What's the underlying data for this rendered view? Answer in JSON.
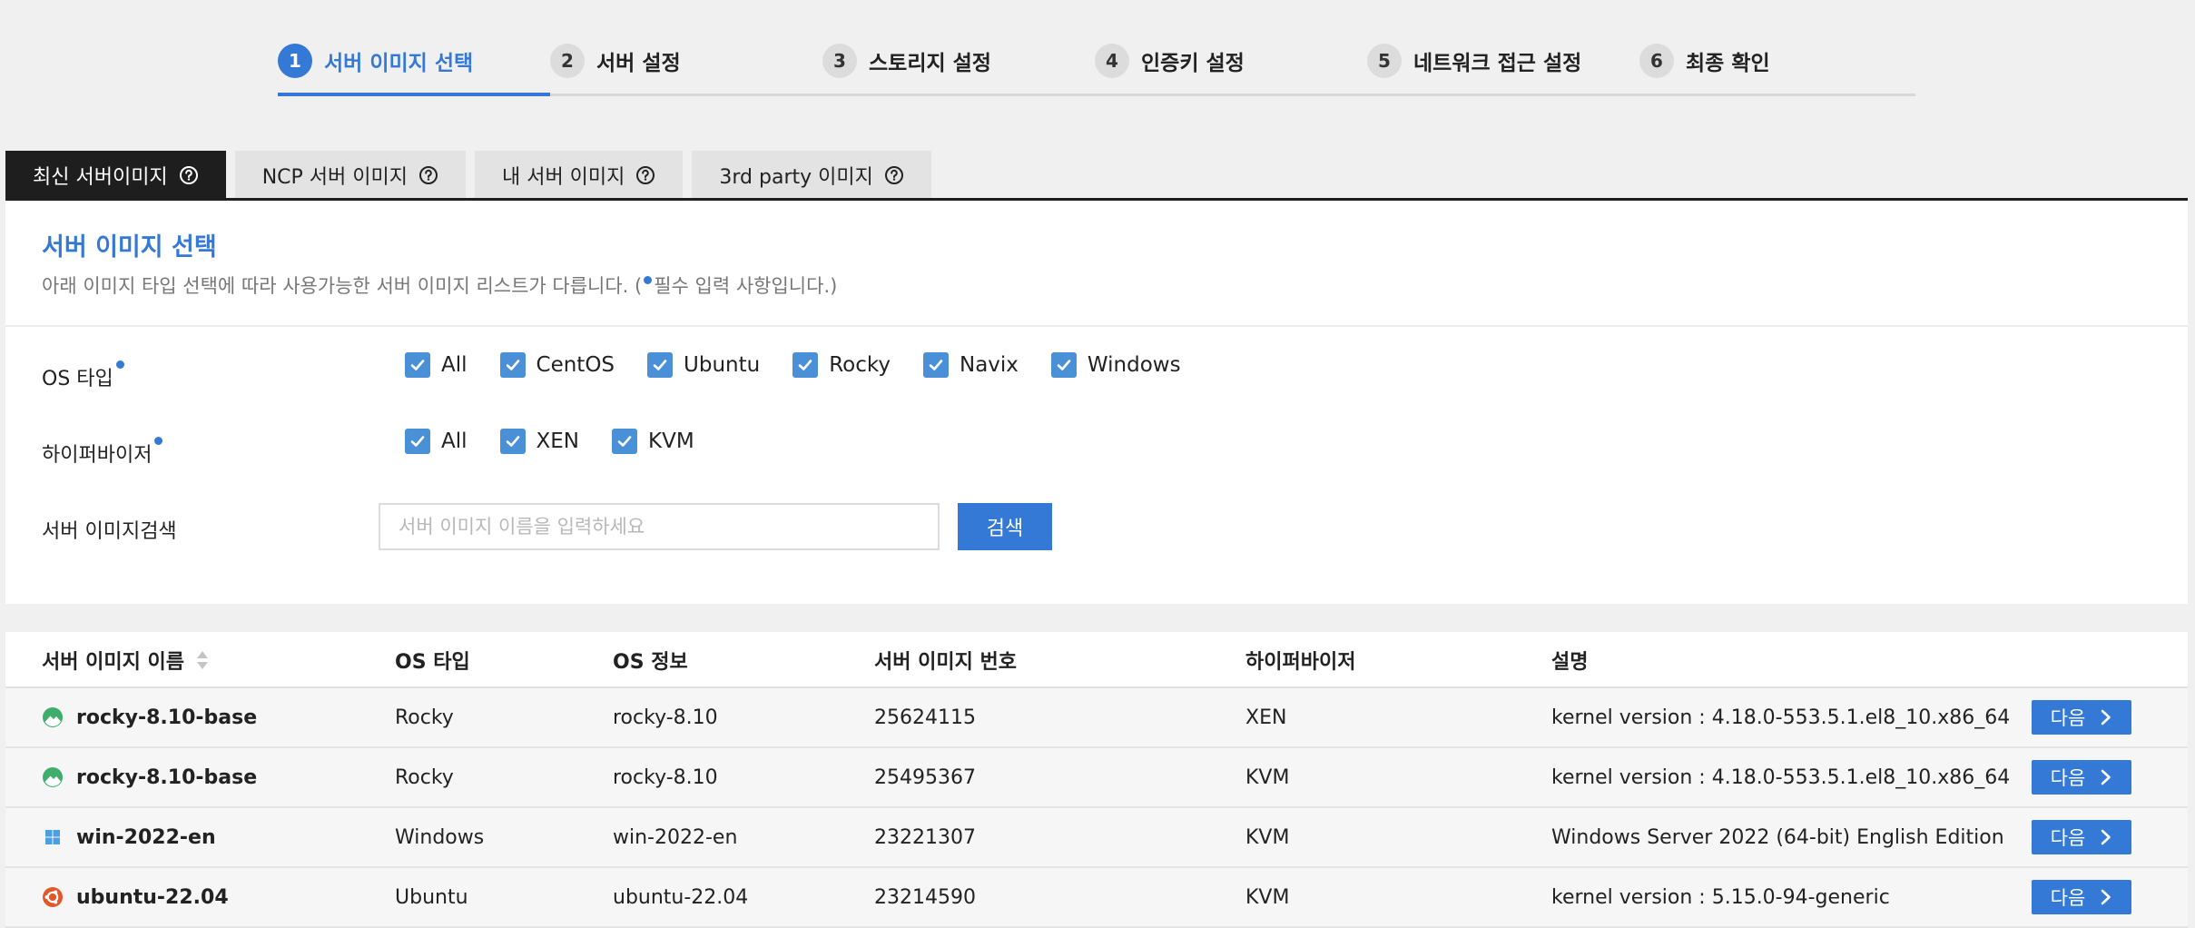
{
  "stepper": {
    "steps": [
      {
        "num": "1",
        "label": "서버 이미지 선택"
      },
      {
        "num": "2",
        "label": "서버 설정"
      },
      {
        "num": "3",
        "label": "스토리지 설정"
      },
      {
        "num": "4",
        "label": "인증키 설정"
      },
      {
        "num": "5",
        "label": "네트워크 접근 설정"
      },
      {
        "num": "6",
        "label": "최종 확인"
      }
    ],
    "active_step": 1
  },
  "tabs": [
    {
      "label": "최신 서버이미지",
      "icon": "help-circle-icon",
      "active": true
    },
    {
      "label": "NCP 서버 이미지",
      "icon": "help-circle-icon",
      "active": false
    },
    {
      "label": "내 서버 이미지",
      "icon": "help-circle-icon",
      "active": false
    },
    {
      "label": "3rd party 이미지",
      "icon": "help-circle-icon",
      "active": false
    }
  ],
  "panel": {
    "title": "서버 이미지 선택",
    "desc_before": "아래 이미지 타입 선택에 따라 사용가능한 서버 이미지 리스트가 다릅니다. (",
    "desc_after": "필수 입력 사항입니다.)"
  },
  "filters": {
    "os_type": {
      "label": "OS 타입",
      "options": [
        {
          "label": "All",
          "checked": true
        },
        {
          "label": "CentOS",
          "checked": true
        },
        {
          "label": "Ubuntu",
          "checked": true
        },
        {
          "label": "Rocky",
          "checked": true
        },
        {
          "label": "Navix",
          "checked": true
        },
        {
          "label": "Windows",
          "checked": true
        }
      ]
    },
    "hypervisor": {
      "label": "하이퍼바이저",
      "options": [
        {
          "label": "All",
          "checked": true
        },
        {
          "label": "XEN",
          "checked": true
        },
        {
          "label": "KVM",
          "checked": true
        }
      ]
    },
    "search": {
      "label": "서버 이미지검색",
      "placeholder": "서버 이미지 이름을 입력하세요",
      "value": "",
      "button_label": "검색"
    }
  },
  "table": {
    "columns": {
      "name": "서버 이미지 이름",
      "os_type": "OS 타입",
      "os_info": "OS 정보",
      "image_num": "서버 이미지 번호",
      "hypervisor": "하이퍼바이저",
      "description": "설명"
    },
    "rows": [
      {
        "icon": "rocky-icon",
        "name": "rocky-8.10-base",
        "os_type": "Rocky",
        "os_info": "rocky-8.10",
        "image_num": "25624115",
        "hypervisor": "XEN",
        "description": "kernel version : 4.18.0-553.5.1.el8_10.x86_64",
        "action": "다음"
      },
      {
        "icon": "rocky-icon",
        "name": "rocky-8.10-base",
        "os_type": "Rocky",
        "os_info": "rocky-8.10",
        "image_num": "25495367",
        "hypervisor": "KVM",
        "description": "kernel version : 4.18.0-553.5.1.el8_10.x86_64",
        "action": "다음"
      },
      {
        "icon": "windows-icon",
        "name": "win-2022-en",
        "os_type": "Windows",
        "os_info": "win-2022-en",
        "image_num": "23221307",
        "hypervisor": "KVM",
        "description": "Windows Server 2022 (64-bit) English Edition",
        "action": "다음"
      },
      {
        "icon": "ubuntu-icon",
        "name": "ubuntu-22.04",
        "os_type": "Ubuntu",
        "os_info": "ubuntu-22.04",
        "image_num": "23214590",
        "hypervisor": "KVM",
        "description": "kernel version : 5.15.0-94-generic",
        "action": "다음"
      }
    ]
  },
  "colors": {
    "accent": "#3579d6",
    "tab_active_bg": "#1e1e1e",
    "checkbox": "#4a90d6",
    "rocky_green": "#3fae6c",
    "ubuntu_orange": "#e2582b",
    "windows_blue": "#4a9fe0"
  }
}
